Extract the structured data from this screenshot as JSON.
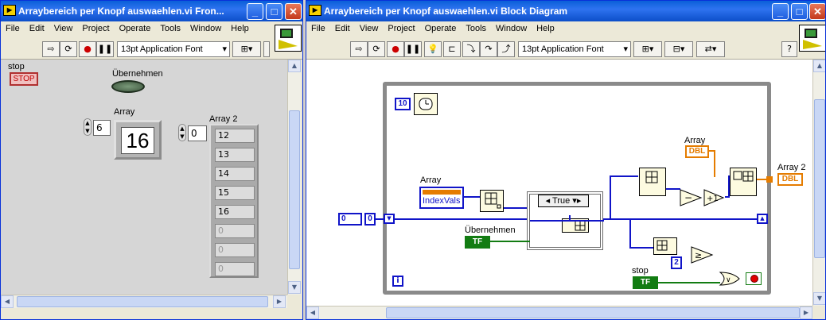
{
  "front_panel": {
    "title": "Arraybereich per Knopf auswaehlen.vi Fron...",
    "menu": [
      "File",
      "Edit",
      "View",
      "Project",
      "Operate",
      "Tools",
      "Window",
      "Help"
    ],
    "font": "13pt Application Font",
    "controls": {
      "stop_label": "stop",
      "stop_button": "STOP",
      "uebernehmen_label": "Übernehmen",
      "array_label": "Array",
      "array_index": "6",
      "array_value": "16",
      "array2_label": "Array 2",
      "array2_index": "0",
      "array2_values": [
        "12",
        "13",
        "14",
        "15",
        "16",
        "0",
        "0",
        "0"
      ]
    }
  },
  "block_diagram": {
    "title": "Arraybereich per Knopf auswaehlen.vi Block Diagram",
    "menu": [
      "File",
      "Edit",
      "View",
      "Project",
      "Operate",
      "Tools",
      "Window",
      "Help"
    ],
    "font": "13pt Application Font",
    "labels": {
      "wait_const": "10",
      "array_label": "Array",
      "indexvals": "IndexVals",
      "uebernehmen": "Übernehmen",
      "tf": "TF",
      "case_selector": "True",
      "array_top": "Array",
      "dbl": "DBL",
      "array2": "Array 2",
      "dbl2": "DBL",
      "stop": "stop",
      "tf2": "TF",
      "const2": "2",
      "shift_init": "0",
      "shift_init2": "0",
      "loop_iter": "i"
    }
  },
  "colors": {
    "titlebar": "#0a5fd8",
    "wire_blue": "#1014c8",
    "wire_green": "#127c12",
    "wire_orange": "#e57c00"
  }
}
